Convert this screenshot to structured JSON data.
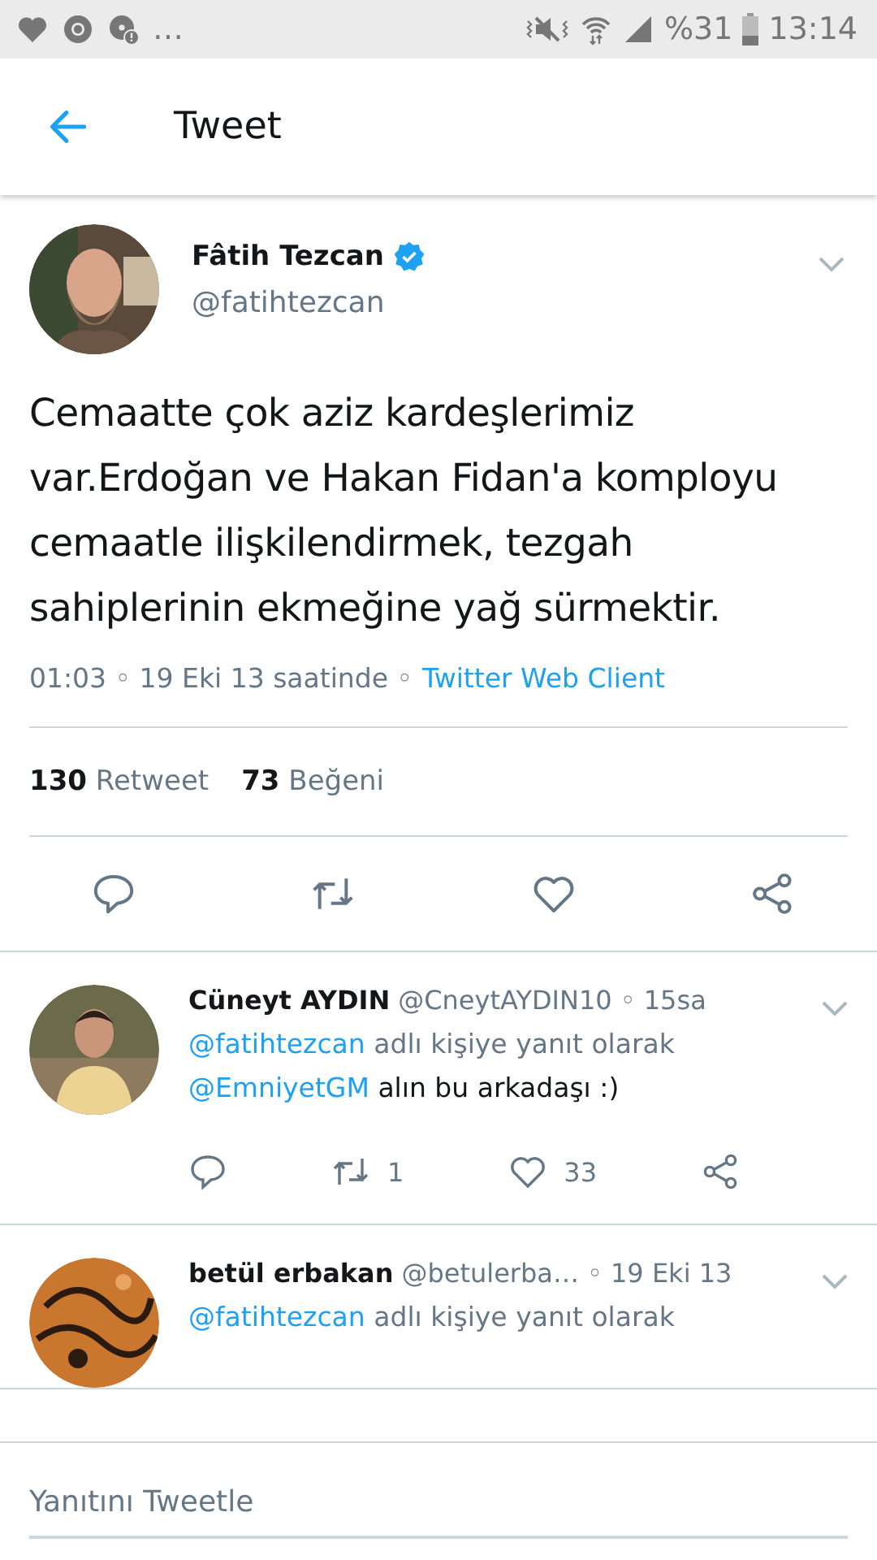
{
  "status_bar": {
    "more": "…",
    "battery": "%31",
    "time": "13:14"
  },
  "header": {
    "title": "Tweet"
  },
  "tweet": {
    "name": "Fâtih Tezcan",
    "verified": true,
    "handle": "@fatihtezcan",
    "text": "Cemaatte çok aziz kardeşlerimiz var.Erdoğan ve Hakan Fidan'a komployu cemaatle ilişkilendirmek, tezgah sahiplerinin ekmeğine yağ sürmektir.",
    "meta": "01:03 ◦ 19 Eki 13 saatinde ◦",
    "source": "Twitter Web Client",
    "retweets": {
      "count": "130",
      "label": "Retweet"
    },
    "likes": {
      "count": "73",
      "label": "Beğeni"
    }
  },
  "replies": [
    {
      "name": "Cüneyt AYDIN",
      "handle": "@CneytAYDIN10",
      "time": "◦ 15sa",
      "reply_mention": "@fatihtezcan",
      "reply_label": "adlı kişiye yanıt olarak",
      "body_mention": "@EmniyetGM",
      "body": "alın bu arkadaşı :)",
      "retweets": "1",
      "likes": "33"
    },
    {
      "name": "betül erbakan",
      "handle": "@betulerba…",
      "time": "◦ 19 Eki 13",
      "reply_mention": "@fatihtezcan",
      "reply_label": "adlı kişiye yanıt olarak"
    }
  ],
  "compose": {
    "placeholder": "Yanıtını Tweetle"
  }
}
